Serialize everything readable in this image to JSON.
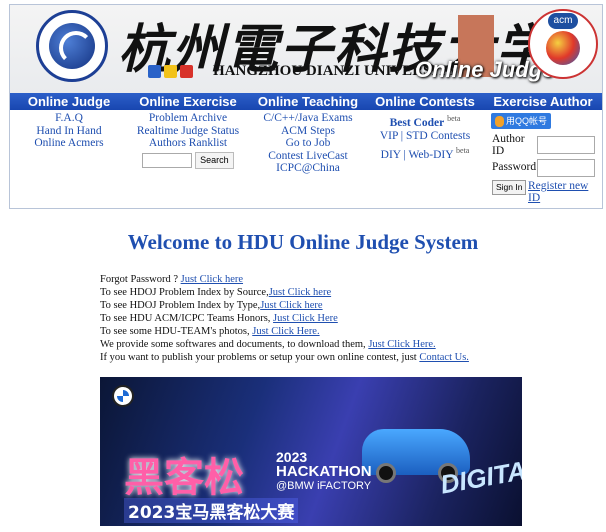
{
  "header": {
    "calligraphy_title": "杭州電子科技大学",
    "university": "HANGZHOU DIANZI UNIVERSITY",
    "site_title": "Online Judge",
    "acm_badge": "acm"
  },
  "nav": {
    "online_judge": "Online Judge",
    "online_exercise": "Online Exercise",
    "online_teaching": "Online Teaching",
    "online_contests": "Online Contests",
    "exercise_author": "Exercise Author"
  },
  "judge_links": [
    "F.A.Q",
    "Hand In Hand",
    "Online Acmers"
  ],
  "exercise_links": [
    "Problem Archive",
    "Realtime Judge Status",
    "Authors Ranklist"
  ],
  "search": {
    "button": "Search",
    "value": ""
  },
  "teaching_links": [
    "C/C++/Java Exams",
    "ACM Steps",
    "Go to Job",
    "Contest LiveCast",
    "ICPC@China"
  ],
  "contests": {
    "best_coder": "Best Coder",
    "beta1": "beta",
    "vip_std": "VIP | STD Contests",
    "diy": "DIY | Web-DIY",
    "beta2": "beta"
  },
  "author": {
    "qq_login": "用QQ帐号登录",
    "author_id_label": "Author ID",
    "password_label": "Password",
    "signin": "Sign In",
    "register": "Register new ID"
  },
  "welcome": "Welcome to HDU Online Judge System",
  "info_lines": [
    {
      "text": "Forgot Password ? ",
      "link": "Just Click here"
    },
    {
      "text": "To see HDOJ Problem Index by Source,",
      "link": "Just Click here"
    },
    {
      "text": "To see HDOJ Problem Index by Type,",
      "link": "Just Click here"
    },
    {
      "text": "To see HDU ACM/ICPC Teams Honors, ",
      "link": "Just Click Here"
    },
    {
      "text": "To see some HDU-TEAM's photos, ",
      "link": "Just Click Here."
    },
    {
      "text": "We provide some softwares and documents, to download them, ",
      "link": "Just Click Here."
    },
    {
      "text": "If you want to publish your problems or setup your own online contest, just ",
      "link": "Contact Us."
    }
  ],
  "banner": {
    "cn_title": "黑客松",
    "year": "2023",
    "hackathon": "HACKATHON",
    "factory": "@BMW iFACTORY",
    "bottom": "2023宝马黑客松大赛",
    "digital": "DIGITAL"
  }
}
